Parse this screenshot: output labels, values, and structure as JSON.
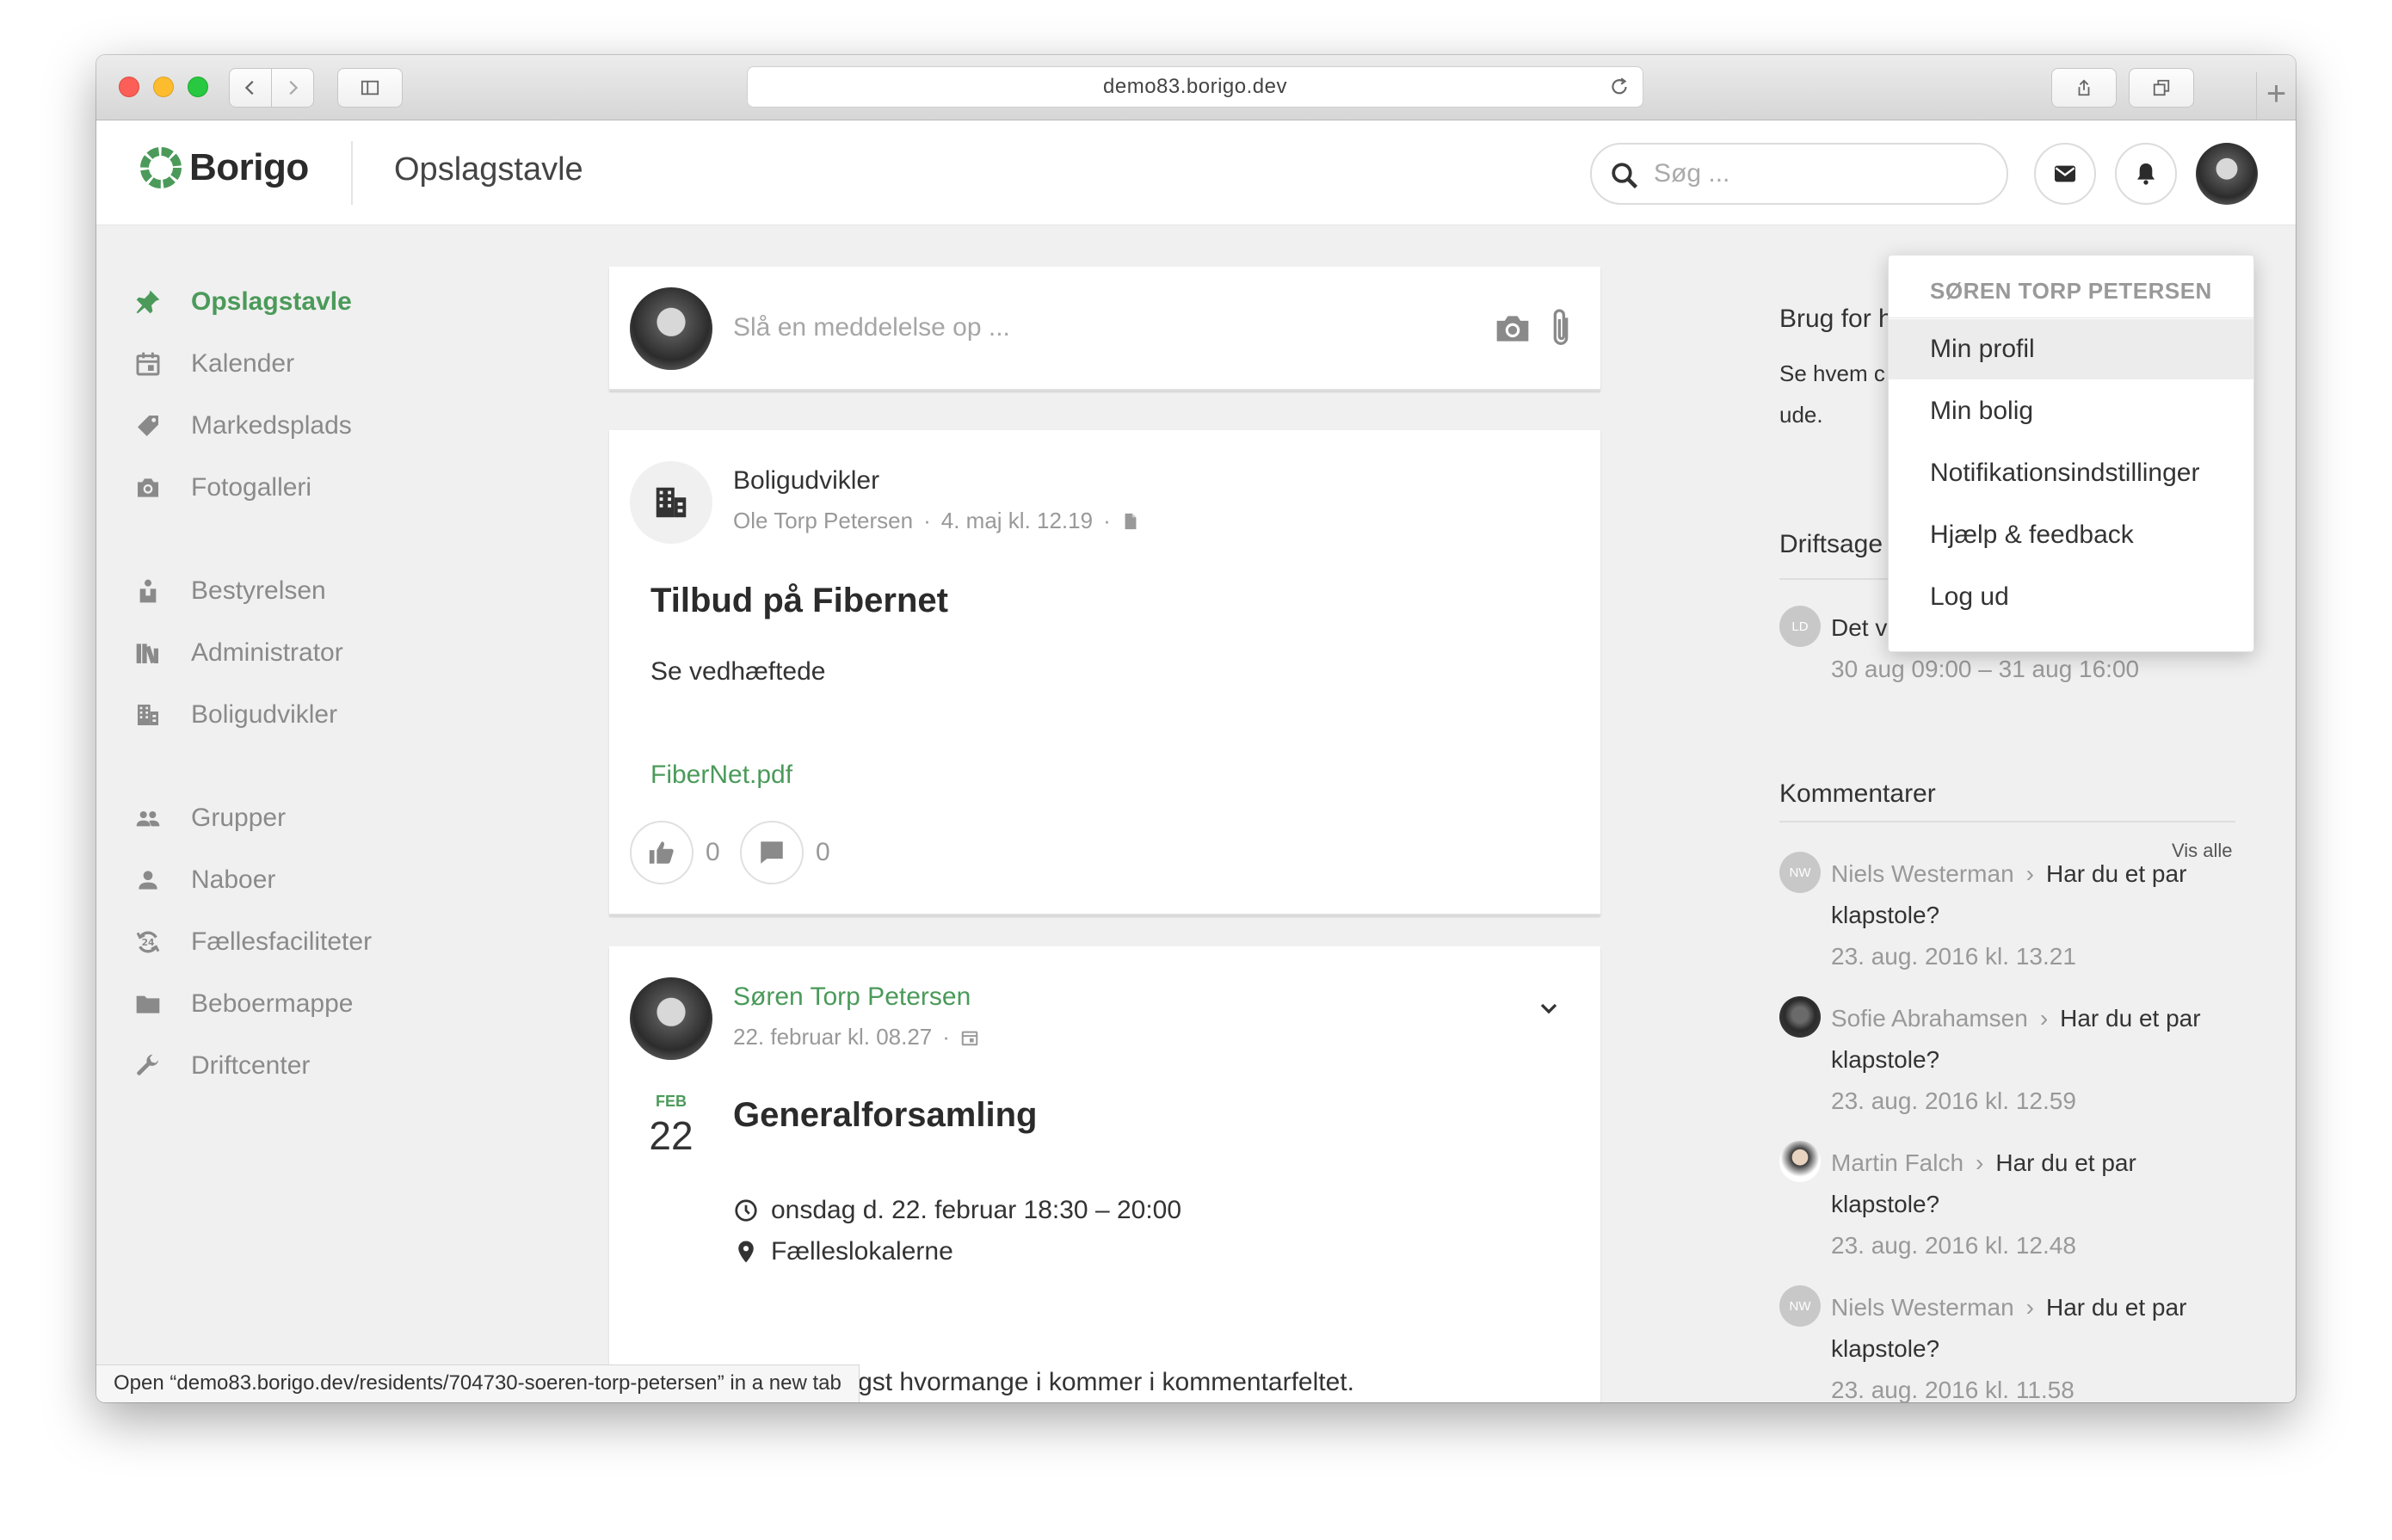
{
  "browser": {
    "url": "demo83.borigo.dev",
    "status_text": "Open “demo83.borigo.dev/residents/704730-soeren-torp-petersen” in a new tab"
  },
  "header": {
    "logo_text": "Borigo",
    "page_title": "Opslagstavle",
    "search_placeholder": "Søg ..."
  },
  "sidebar": {
    "items": [
      {
        "label": "Opslagstavle",
        "icon": "pin-icon",
        "active": true
      },
      {
        "label": "Kalender",
        "icon": "calendar-icon"
      },
      {
        "label": "Markedsplads",
        "icon": "tag-icon"
      },
      {
        "label": "Fotogalleri",
        "icon": "camera-icon"
      },
      {
        "label": "Bestyrelsen",
        "icon": "board-icon"
      },
      {
        "label": "Administrator",
        "icon": "books-icon"
      },
      {
        "label": "Boligudvikler",
        "icon": "building-icon"
      },
      {
        "label": "Grupper",
        "icon": "group-icon"
      },
      {
        "label": "Naboer",
        "icon": "person-icon"
      },
      {
        "label": "Fællesfaciliteter",
        "icon": "facilities-icon"
      },
      {
        "label": "Beboermappe",
        "icon": "folder-icon"
      },
      {
        "label": "Driftcenter",
        "icon": "wrench-icon"
      }
    ]
  },
  "composer": {
    "placeholder": "Slå en meddelelse op ..."
  },
  "post1": {
    "author": "Boligudvikler",
    "by": "Ole Torp Petersen",
    "date": "4. maj kl. 12.19",
    "title": "Tilbud på Fibernet",
    "body": "Se vedhæftede",
    "attachment": "FiberNet.pdf",
    "likes": "0",
    "comments": "0"
  },
  "post2": {
    "author": "Søren Torp Petersen",
    "date": "22. februar kl. 08.27",
    "month": "FEB",
    "day": "22",
    "title": "Generalforsamling",
    "when": "onsdag d. 22. februar 18:30 – 20:00",
    "where": "Fælleslokalerne",
    "body": "Angiv venligst hvormange i kommer i kommentarfeltet."
  },
  "right": {
    "help_title": "Brug for h",
    "help_text_1": "Se hvem c",
    "help_text_2": "ude.",
    "ops_title": "Driftsage",
    "event": {
      "initials": "LD",
      "title": "Det varme vand lukkes",
      "time": "30 aug 09:00 – 31 aug 16:00"
    },
    "comments_title": "Kommentarer",
    "see_all": "Vis alle",
    "comments": [
      {
        "initials": "NW",
        "name": "Niels Westerman",
        "text1": "Har du et par",
        "text2": "klapstole?",
        "date": "23. aug. 2016 kl. 13.21"
      },
      {
        "initials": "",
        "name": "Sofie Abrahamsen",
        "text1": "Har du et par",
        "text2": "klapstole?",
        "date": "23. aug. 2016 kl. 12.59"
      },
      {
        "initials": "",
        "name": "Martin Falch",
        "text1": "Har du et par",
        "text2": "klapstole?",
        "date": "23. aug. 2016 kl. 12.48"
      },
      {
        "initials": "NW",
        "name": "Niels Westerman",
        "text1": "Har du et par",
        "text2": "klapstole?",
        "date": "23. aug. 2016 kl. 11.58"
      }
    ]
  },
  "dropdown": {
    "user": "SØREN TORP PETERSEN",
    "items": [
      "Min profil",
      "Min bolig",
      "Notifikationsindstillinger",
      "Hjælp & feedback",
      "Log ud"
    ]
  },
  "colors": {
    "accent": "#4b9a5a",
    "muted": "#8a8a8a"
  }
}
